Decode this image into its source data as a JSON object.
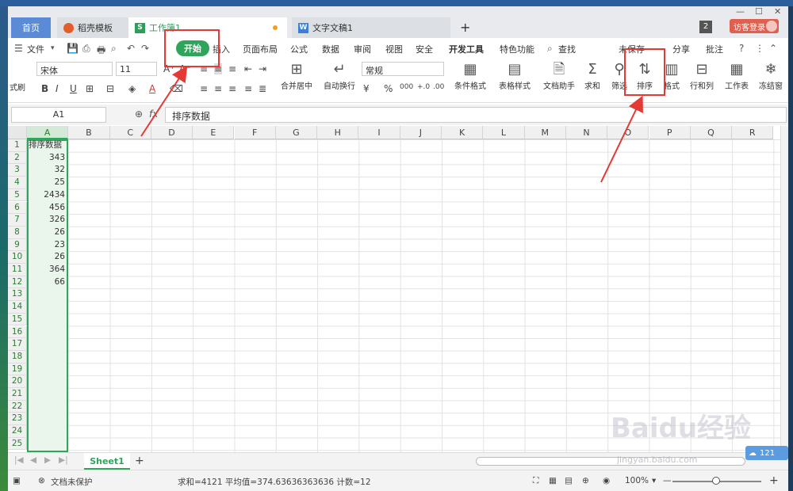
{
  "tabs": [
    {
      "label": "首页"
    },
    {
      "label": "稻壳模板"
    },
    {
      "label": "工作簿1"
    },
    {
      "label": "文字文稿1"
    }
  ],
  "tab_badge": "2",
  "login_label": "访客登录",
  "menu": {
    "file": "文件",
    "items": [
      "开始",
      "插入",
      "页面布局",
      "公式",
      "数据",
      "审阅",
      "视图",
      "安全",
      "开发工具",
      "特色功能"
    ],
    "search": "查找",
    "unsaved": "未保存",
    "share": "分享",
    "comment": "批注"
  },
  "ribbon": {
    "font_name": "宋体",
    "font_size": "11",
    "number_format": "常规",
    "format_painter": "式刷",
    "merge_center": "合并居中",
    "wrap_text": "自动换行",
    "conditional_format": "条件格式",
    "table_style": "表格样式",
    "doc_assistant": "文档助手",
    "sum": "求和",
    "filter": "筛选",
    "sort": "排序",
    "format": "格式",
    "rows_cols": "行和列",
    "worksheet": "工作表",
    "freeze": "冻结窗"
  },
  "formula_bar": {
    "cell_ref": "A1",
    "content": "排序数据"
  },
  "columns": [
    "A",
    "B",
    "C",
    "D",
    "E",
    "F",
    "G",
    "H",
    "I",
    "J",
    "K",
    "L",
    "M",
    "N",
    "O",
    "P",
    "Q",
    "R"
  ],
  "rows": [
    "1",
    "2",
    "3",
    "4",
    "5",
    "6",
    "7",
    "8",
    "9",
    "10",
    "11",
    "12",
    "13",
    "14",
    "15",
    "16",
    "17",
    "18",
    "19",
    "20",
    "21",
    "22",
    "23",
    "24",
    "25"
  ],
  "column_a": [
    "排序数据",
    "343",
    "32",
    "25",
    "2434",
    "456",
    "326",
    "26",
    "23",
    "26",
    "364",
    "66"
  ],
  "sheet_tab": "Sheet1",
  "status": {
    "protection": "文档未保护",
    "summary": "求和=4121  平均值=374.63636363636  计数=12",
    "zoom": "100%"
  },
  "watermark": "Baidu经验",
  "watermark_url": "jingyan.baidu.com",
  "cloud_count": "121",
  "colors": {
    "accent_green": "#2ea55a",
    "annotation_red": "#e53935",
    "login_red": "#e06050"
  }
}
